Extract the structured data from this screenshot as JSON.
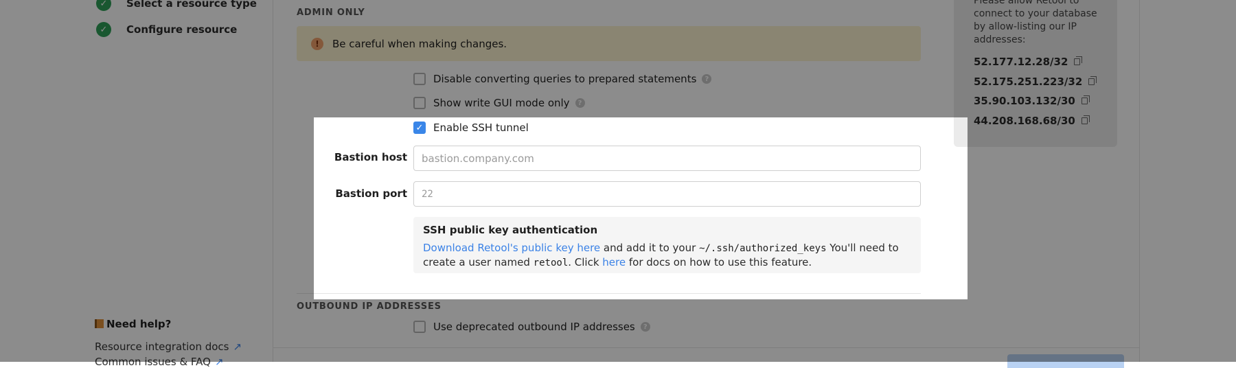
{
  "sidebar": {
    "steps": [
      {
        "label": "Select a resource type"
      },
      {
        "label": "Configure resource"
      }
    ],
    "help": {
      "title": "Need help?",
      "links": [
        {
          "label": "Resource integration docs"
        },
        {
          "label": "Common issues & FAQ"
        }
      ]
    }
  },
  "admin": {
    "section_label": "ADMIN ONLY",
    "warning": "Be careful when making changes.",
    "options": [
      {
        "label": "Disable converting queries to prepared statements",
        "checked": false
      },
      {
        "label": "Show write GUI mode only",
        "checked": false
      },
      {
        "label": "Enable SSH tunnel",
        "checked": true
      }
    ]
  },
  "ssh": {
    "bastion_host_label": "Bastion host",
    "bastion_host_placeholder": "bastion.company.com",
    "bastion_port_label": "Bastion port",
    "bastion_port_placeholder": "22",
    "info_title": "SSH public key authentication",
    "download_link": "Download Retool's public key here",
    "text_1": " and add it to your ",
    "path": "~/.ssh/authorized_keys",
    "text_2": " You'll need to create a user named ",
    "username": "retool",
    "text_3": ". Click ",
    "docs_link": "here",
    "text_4": " for docs on how to use this feature."
  },
  "outbound": {
    "section_label": "OUTBOUND IP ADDRESSES",
    "option_label": "Use deprecated outbound IP addresses"
  },
  "ip_panel": {
    "description": "Please allow Retool to connect to your database by allow-listing our IP addresses:",
    "ips": [
      "52.177.12.28/32",
      "52.175.251.223/32",
      "35.90.103.132/30",
      "44.208.168.68/30"
    ]
  },
  "colors": {
    "accent": "#3a86e8",
    "success": "#2f9e58",
    "warning_bg": "#fcf2cf"
  }
}
